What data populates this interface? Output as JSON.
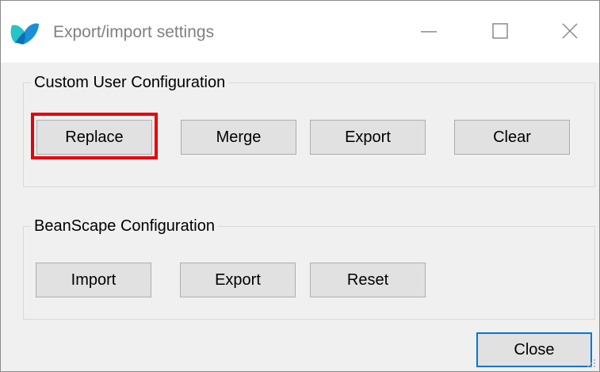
{
  "window": {
    "title": "Export/import settings",
    "icon": "beanscape-app-icon",
    "controls": {
      "minimize_icon": "minimize-icon",
      "maximize_icon": "maximize-icon",
      "close_icon": "close-x-icon"
    }
  },
  "custom_user_configuration": {
    "label": "Custom User Configuration",
    "buttons": {
      "replace": "Replace",
      "merge": "Merge",
      "export": "Export",
      "clear": "Clear"
    },
    "highlighted_button": "replace"
  },
  "beanscape_configuration": {
    "label": "BeanScape Configuration",
    "buttons": {
      "import": "Import",
      "export": "Export",
      "reset": "Reset"
    }
  },
  "footer": {
    "close_label": "Close"
  },
  "colors": {
    "highlight": "#e8000b",
    "default_button_border": "#0078d7",
    "icon_primary": "#1a8fd6",
    "icon_secondary": "#27c3c7"
  }
}
